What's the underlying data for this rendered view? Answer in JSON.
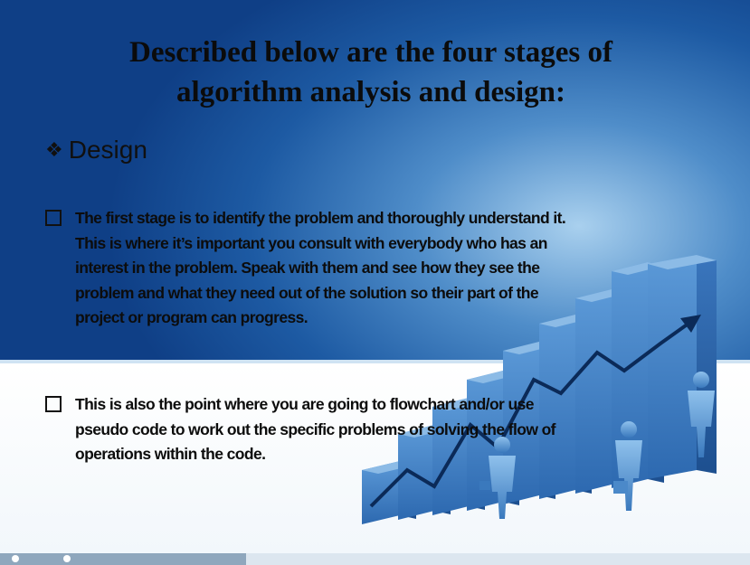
{
  "slide": {
    "title_line1": "Described below are the four stages of",
    "title_line2": "algorithm analysis and design:",
    "heading": "Design",
    "bullets": [
      {
        "lines": [
          "The first stage is to identify the problem and thoroughly understand it.",
          "This is where it’s important you consult with everybody who has an",
          "interest in the problem. Speak with them and see how they see the",
          "problem and what they need out of the solution so their part of the",
          "project or program can progress."
        ]
      },
      {
        "lines": [
          "This is also the point where you are going to flowchart and/or use",
          "pseudo code to work out the specific problems of solving the flow of",
          "operations within the code."
        ]
      }
    ]
  },
  "colors": {
    "bg_dark": "#0f3f86",
    "bg_light": "#a9d0ee",
    "bar_blue": "#3f7fc6"
  }
}
